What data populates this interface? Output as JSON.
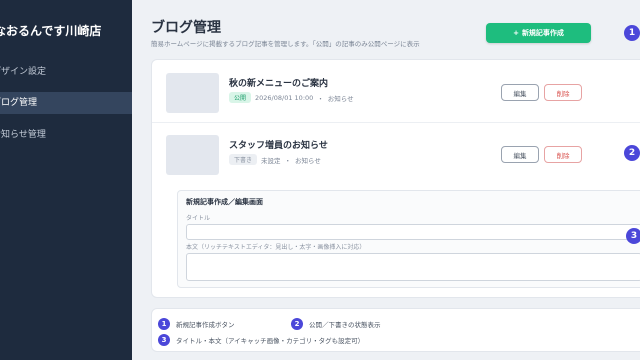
{
  "sidebar": {
    "brand": "なおるんです川崎店",
    "items": [
      {
        "label": "デザイン設定"
      },
      {
        "label": "ブログ管理"
      },
      {
        "label": "お知らせ管理"
      }
    ]
  },
  "header": {
    "title": "ブログ管理",
    "description": "簡易ホームページに掲載するブログ記事を管理します。「公開」の記事のみ公開ページに表示",
    "new_button_plus": "+",
    "new_button_label": "新規記事作成"
  },
  "markers": [
    "1",
    "2",
    "3"
  ],
  "posts": [
    {
      "title": "秋の新メニューのご案内",
      "status": "公開",
      "date": "2026/08/01 10:00",
      "separator": "・",
      "category": "お知らせ",
      "edit_label": "編集",
      "delete_label": "削除"
    },
    {
      "title": "スタッフ増員のお知らせ",
      "status": "下書き",
      "date": "未設定",
      "separator": "・",
      "category": "お知らせ",
      "edit_label": "編集",
      "delete_label": "削除"
    }
  ],
  "editor": {
    "title": "新規記事作成／編集画面",
    "title_field_label": "タイトル",
    "body_field_label": "本文（リッチテキストエディタ：見出し・太字・画像挿入に対応）"
  },
  "legend": [
    {
      "num": "1",
      "text": "新規記事作成ボタン"
    },
    {
      "num": "2",
      "text": "公開／下書きの状態表示"
    },
    {
      "num": "3",
      "text": "タイトル・本文（アイキャッチ画像・カテゴリ・タグも設定可）"
    }
  ],
  "colors": {
    "sidebar_bg": "#1e2b3e",
    "accent_green": "#1ebd7e",
    "marker": "#4b47d9",
    "danger": "#d9534f"
  }
}
